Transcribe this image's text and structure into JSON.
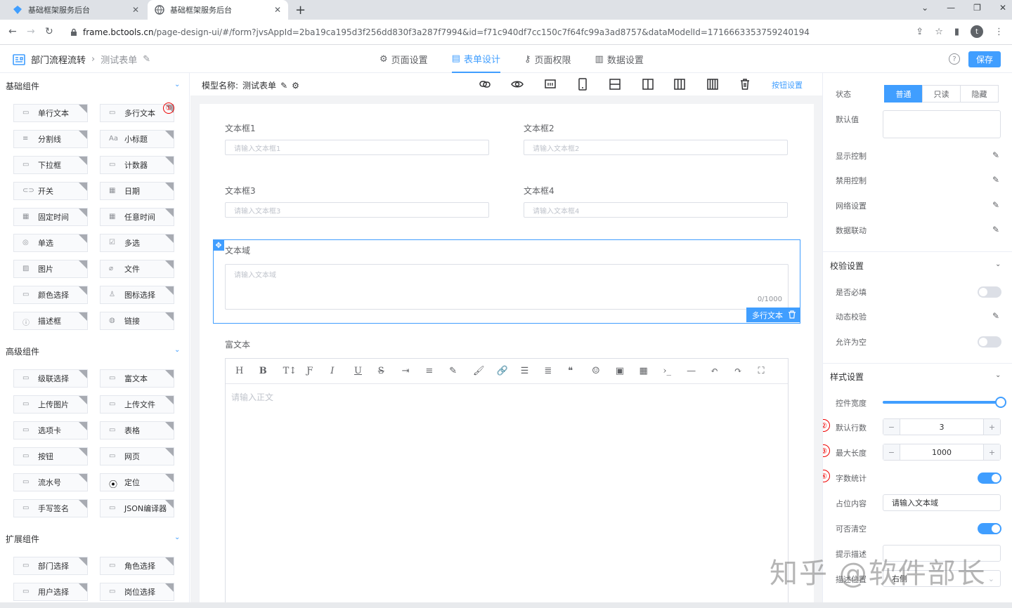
{
  "browser": {
    "tabs": [
      {
        "title": "基础框架服务后台",
        "active": false
      },
      {
        "title": "基础框架服务后台",
        "active": true
      }
    ],
    "url_host": "frame.bctools.cn",
    "url_path": "/page-design-ui/#/form?jvsAppId=2ba19ca195d3f256dd830f3a287f7994&id=f71c940df7cc150c7f64fc99a3ad8757&dataModelId=1716663353759240194",
    "avatar_letter": "t"
  },
  "header": {
    "breadcrumb": [
      "部门流程流转",
      "测试表单"
    ],
    "nav": [
      {
        "label": "页面设置",
        "active": false
      },
      {
        "label": "表单设计",
        "active": true
      },
      {
        "label": "页面权限",
        "active": false
      },
      {
        "label": "数据设置",
        "active": false
      }
    ],
    "help": "?",
    "save_label": "保存"
  },
  "left": {
    "groups": [
      {
        "title": "基础组件",
        "items": [
          "单行文本",
          "多行文本",
          "分割线",
          "小标题",
          "下拉框",
          "计数器",
          "开关",
          "日期",
          "固定时间",
          "任意时间",
          "单选",
          "多选",
          "图片",
          "文件",
          "颜色选择",
          "图标选择",
          "描述框",
          "链接"
        ]
      },
      {
        "title": "高级组件",
        "items": [
          "级联选择",
          "富文本",
          "上传图片",
          "上传文件",
          "选项卡",
          "表格",
          "按钮",
          "网页",
          "流水号",
          "定位",
          "手写签名",
          "JSON编译器"
        ]
      },
      {
        "title": "扩展组件",
        "items": [
          "部门选择",
          "角色选择",
          "用户选择",
          "岗位选择"
        ]
      }
    ],
    "marker1": "①"
  },
  "center": {
    "model_label": "模型名称:",
    "model_name": "测试表单",
    "button_settings": "按钮设置",
    "fields": [
      {
        "label": "文本框1",
        "placeholder": "请输入文本框1"
      },
      {
        "label": "文本框2",
        "placeholder": "请输入文本框2"
      },
      {
        "label": "文本框3",
        "placeholder": "请输入文本框3"
      },
      {
        "label": "文本框4",
        "placeholder": "请输入文本框4"
      }
    ],
    "textarea": {
      "label": "文本域",
      "placeholder": "请输入文本域",
      "counter": "0/1000",
      "tag": "多行文本"
    },
    "richtext": {
      "label": "富文本",
      "placeholder": "请输入正文"
    }
  },
  "right": {
    "status_label": "状态",
    "status_options": [
      "普通",
      "只读",
      "隐藏"
    ],
    "status_selected": "普通",
    "default_value_label": "默认值",
    "links": [
      "显示控制",
      "禁用控制",
      "网络设置",
      "数据联动"
    ],
    "validation": {
      "title": "校验设置",
      "required": "是否必填",
      "dynamic": "动态校验",
      "allow_empty": "允许为空"
    },
    "style": {
      "title": "样式设置",
      "width_label": "控件宽度",
      "width_percent": 100,
      "rows_label": "默认行数",
      "rows_value": "3",
      "maxlen_label": "最大长度",
      "maxlen_value": "1000",
      "wordcount_label": "字数统计",
      "placeholder_label": "占位内容",
      "placeholder_value": "请输入文本域",
      "clearable_label": "可否清空",
      "hint_label": "提示描述",
      "desc_pos_label": "描述位置",
      "desc_pos_value": "右侧"
    },
    "markers": [
      "②",
      "③",
      "④"
    ],
    "stepper_minus": "−",
    "stepper_plus": "+"
  },
  "watermark": "知乎 @软件部长",
  "colors": {
    "accent": "#409eff",
    "marker": "#e00000"
  }
}
